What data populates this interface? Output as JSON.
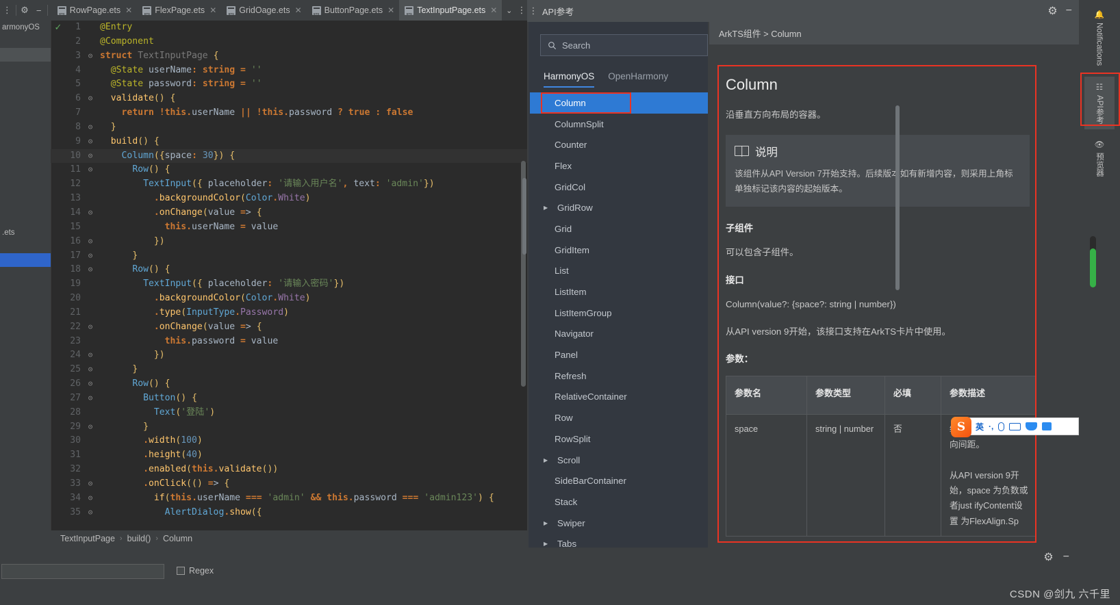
{
  "ide": {
    "toolbar_icons": [
      "collapse-icon",
      "settings-gear-icon",
      "minimize-icon"
    ],
    "tabs": [
      {
        "label": "RowPage.ets",
        "active": false
      },
      {
        "label": "FlexPage.ets",
        "active": false
      },
      {
        "label": "GridOage.ets",
        "active": false
      },
      {
        "label": "ButtonPage.ets",
        "active": false
      },
      {
        "label": "TextInputPage.ets",
        "active": true
      }
    ],
    "tabs_overflow_label": "⌄",
    "left_rail": [
      "armonyOS",
      "",
      "",
      "",
      "",
      "",
      "",
      "",
      "",
      "",
      "",
      "",
      "",
      "",
      "",
      ".ets",
      "",
      ""
    ],
    "breadcrumb": [
      "TextInputPage",
      "build()",
      "Column"
    ],
    "breadcrumb_sep": "›",
    "find_placeholder": "",
    "regex_label": "Regex",
    "valid_check": "✓",
    "code_lines": [
      {
        "n": 1,
        "fold": "",
        "text": "@Entry"
      },
      {
        "n": 2,
        "fold": "",
        "text": "@Component"
      },
      {
        "n": 3,
        "fold": "-",
        "text": "struct TextInputPage {"
      },
      {
        "n": 4,
        "fold": "",
        "text": "  @State userName: string = ''"
      },
      {
        "n": 5,
        "fold": "",
        "text": "  @State password: string = ''"
      },
      {
        "n": 6,
        "fold": "-",
        "text": "  validate() {"
      },
      {
        "n": 7,
        "fold": "",
        "text": "    return !this.userName || !this.password ? true : false"
      },
      {
        "n": 8,
        "fold": "-",
        "text": "  }"
      },
      {
        "n": 9,
        "fold": "-",
        "text": "  build() {"
      },
      {
        "n": 10,
        "fold": "-",
        "text": "    Column({space: 30}) {"
      },
      {
        "n": 11,
        "fold": "-",
        "text": "      Row() {"
      },
      {
        "n": 12,
        "fold": "",
        "text": "        TextInput({ placeholder: '请输入用户名', text: 'admin'})"
      },
      {
        "n": 13,
        "fold": "",
        "text": "          .backgroundColor(Color.White)"
      },
      {
        "n": 14,
        "fold": "-",
        "text": "          .onChange(value => {"
      },
      {
        "n": 15,
        "fold": "",
        "text": "            this.userName = value"
      },
      {
        "n": 16,
        "fold": "-",
        "text": "          })"
      },
      {
        "n": 17,
        "fold": "-",
        "text": "      }"
      },
      {
        "n": 18,
        "fold": "-",
        "text": "      Row() {"
      },
      {
        "n": 19,
        "fold": "",
        "text": "        TextInput({ placeholder: '请输入密码'})"
      },
      {
        "n": 20,
        "fold": "",
        "text": "          .backgroundColor(Color.White)"
      },
      {
        "n": 21,
        "fold": "",
        "text": "          .type(InputType.Password)"
      },
      {
        "n": 22,
        "fold": "-",
        "text": "          .onChange(value => {"
      },
      {
        "n": 23,
        "fold": "",
        "text": "            this.password = value"
      },
      {
        "n": 24,
        "fold": "-",
        "text": "          })"
      },
      {
        "n": 25,
        "fold": "-",
        "text": "      }"
      },
      {
        "n": 26,
        "fold": "-",
        "text": "      Row() {"
      },
      {
        "n": 27,
        "fold": "-",
        "text": "        Button() {"
      },
      {
        "n": 28,
        "fold": "",
        "text": "          Text('登陆')"
      },
      {
        "n": 29,
        "fold": "-",
        "text": "        }"
      },
      {
        "n": 30,
        "fold": "",
        "text": "        .width(100)"
      },
      {
        "n": 31,
        "fold": "",
        "text": "        .height(40)"
      },
      {
        "n": 32,
        "fold": "",
        "text": "        .enabled(this.validate())"
      },
      {
        "n": 33,
        "fold": "-",
        "text": "        .onClick(() => {"
      },
      {
        "n": 34,
        "fold": "-",
        "text": "          if(this.userName === 'admin' && this.password === 'admin123') {"
      },
      {
        "n": 35,
        "fold": "-",
        "text": "            AlertDialog.show({"
      }
    ]
  },
  "api_window": {
    "title": "API参考",
    "header_icons": [
      "gear-icon",
      "minimize-icon"
    ],
    "footer_icons": [
      "gear-icon",
      "minimize-icon"
    ],
    "search": {
      "placeholder": "Search",
      "value": ""
    },
    "tabs": [
      {
        "label": "HarmonyOS",
        "active": true
      },
      {
        "label": "OpenHarmony",
        "active": false
      }
    ],
    "components": [
      {
        "label": "Column",
        "selected": true,
        "expandable": false
      },
      {
        "label": "ColumnSplit",
        "selected": false,
        "expandable": false
      },
      {
        "label": "Counter",
        "selected": false,
        "expandable": false
      },
      {
        "label": "Flex",
        "selected": false,
        "expandable": false
      },
      {
        "label": "GridCol",
        "selected": false,
        "expandable": false
      },
      {
        "label": "GridRow",
        "selected": false,
        "expandable": true
      },
      {
        "label": "Grid",
        "selected": false,
        "expandable": false
      },
      {
        "label": "GridItem",
        "selected": false,
        "expandable": false
      },
      {
        "label": "List",
        "selected": false,
        "expandable": false
      },
      {
        "label": "ListItem",
        "selected": false,
        "expandable": false
      },
      {
        "label": "ListItemGroup",
        "selected": false,
        "expandable": false
      },
      {
        "label": "Navigator",
        "selected": false,
        "expandable": false
      },
      {
        "label": "Panel",
        "selected": false,
        "expandable": false
      },
      {
        "label": "Refresh",
        "selected": false,
        "expandable": false
      },
      {
        "label": "RelativeContainer",
        "selected": false,
        "expandable": false
      },
      {
        "label": "Row",
        "selected": false,
        "expandable": false
      },
      {
        "label": "RowSplit",
        "selected": false,
        "expandable": false
      },
      {
        "label": "Scroll",
        "selected": false,
        "expandable": true
      },
      {
        "label": "SideBarContainer",
        "selected": false,
        "expandable": false
      },
      {
        "label": "Stack",
        "selected": false,
        "expandable": false
      },
      {
        "label": "Swiper",
        "selected": false,
        "expandable": true
      },
      {
        "label": "Tabs",
        "selected": false,
        "expandable": true
      }
    ],
    "doc": {
      "breadcrumb": "ArkTS组件 > Column",
      "heading": "Column",
      "intro": "沿垂直方向布局的容器。",
      "note_title": "说明",
      "note_icon": "book-icon",
      "note_body": "该组件从API Version 7开始支持。后续版本如有新增内容，则采用上角标单独标记该内容的起始版本。",
      "child_heading": "子组件",
      "child_body": "可以包含子组件。",
      "api_heading": "接口",
      "signature": "Column(value?: {space?: string | number})",
      "api_note": "从API version 9开始，该接口支持在ArkTS卡片中使用。",
      "params_heading": "参数：",
      "table": {
        "headers": [
          "参数名",
          "参数类型",
          "必填",
          "参数描述"
        ],
        "rows": [
          [
            "space",
            "string | number",
            "否",
            "纵向布局元素垂直方向间距。\n\n从API version 9开始，space 为负数或者just ifyContent设置 为FlexAlign.Sp"
          ]
        ]
      }
    }
  },
  "tool_rail": [
    {
      "label": "Notifications",
      "icon": "bell-icon",
      "active": false
    },
    {
      "label": "API参考",
      "icon": "api-icon",
      "active": true
    },
    {
      "label": "预览器",
      "icon": "eye-icon",
      "active": false
    }
  ],
  "ime": {
    "logo": "S",
    "items": [
      "英",
      "·,",
      "mic-icon",
      "keyboard-icon",
      "bow-icon",
      "panel-icon"
    ]
  },
  "watermark": "CSDN @剑九 六千里",
  "colors": {
    "accent_blue": "#2e7ad4",
    "highlight_red": "#ea3323",
    "editor_bg": "#2b2b2b",
    "chrome_bg": "#3c3f41",
    "nav_bg": "#333840"
  }
}
